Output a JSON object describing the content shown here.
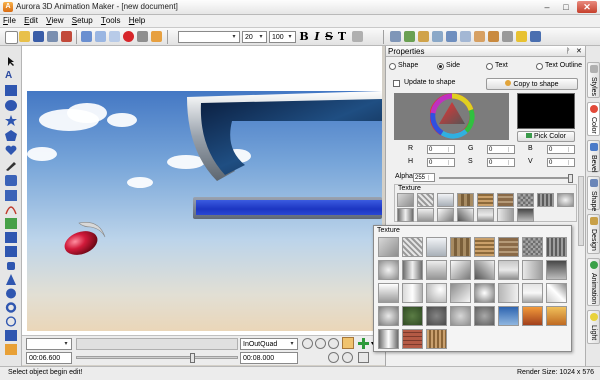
{
  "window": {
    "title": "Aurora 3D Animation Maker - [new document]",
    "app_icon": "A",
    "min_glyph": "–",
    "max_glyph": "□",
    "close_glyph": "✕"
  },
  "menu": {
    "items": [
      {
        "hot": "F",
        "rest": "ile"
      },
      {
        "hot": "E",
        "rest": "dit"
      },
      {
        "hot": "V",
        "rest": "iew"
      },
      {
        "hot": "S",
        "rest": "etup"
      },
      {
        "hot": "T",
        "rest": "ools"
      },
      {
        "hot": "H",
        "rest": "elp"
      }
    ]
  },
  "toolbar": {
    "font_combo": "",
    "font_size": "20",
    "scale": "100",
    "bold": "B",
    "italic": "I",
    "strike": "S",
    "spacing": "T"
  },
  "timeline": {
    "frame_combo": "",
    "easing": "InOutQuad",
    "current_time": "00:06.600",
    "end_time": "00:08.000",
    "slider_position": 0.72
  },
  "status": {
    "message": "Select object begin edit!",
    "render_size": "Render Size: 1024 x 576"
  },
  "properties": {
    "title": "Properties",
    "pin_glyph": "ᚹ",
    "close_glyph": "✕",
    "target_options": [
      "Shape",
      "Side",
      "Text",
      "Text Outline"
    ],
    "selected_target": "Side",
    "update_to_shape": "Update to shape",
    "copy_to_shape": "Copy to shape",
    "pick_color": "Pick Color",
    "color_fields": [
      {
        "label": "R",
        "value": "0"
      },
      {
        "label": "G",
        "value": "0"
      },
      {
        "label": "B",
        "value": "0"
      },
      {
        "label": "H",
        "value": "0"
      },
      {
        "label": "S",
        "value": "0"
      },
      {
        "label": "V",
        "value": "0"
      }
    ],
    "alpha_label": "Alpha",
    "alpha_value": "255",
    "texture_label": "Texture",
    "swatch_color": "#000000"
  },
  "texture_popup": {
    "title": "Texture"
  },
  "side_tabs": [
    "Styles",
    "Color",
    "Bevel",
    "Shape",
    "Design",
    "Animation",
    "Light"
  ]
}
